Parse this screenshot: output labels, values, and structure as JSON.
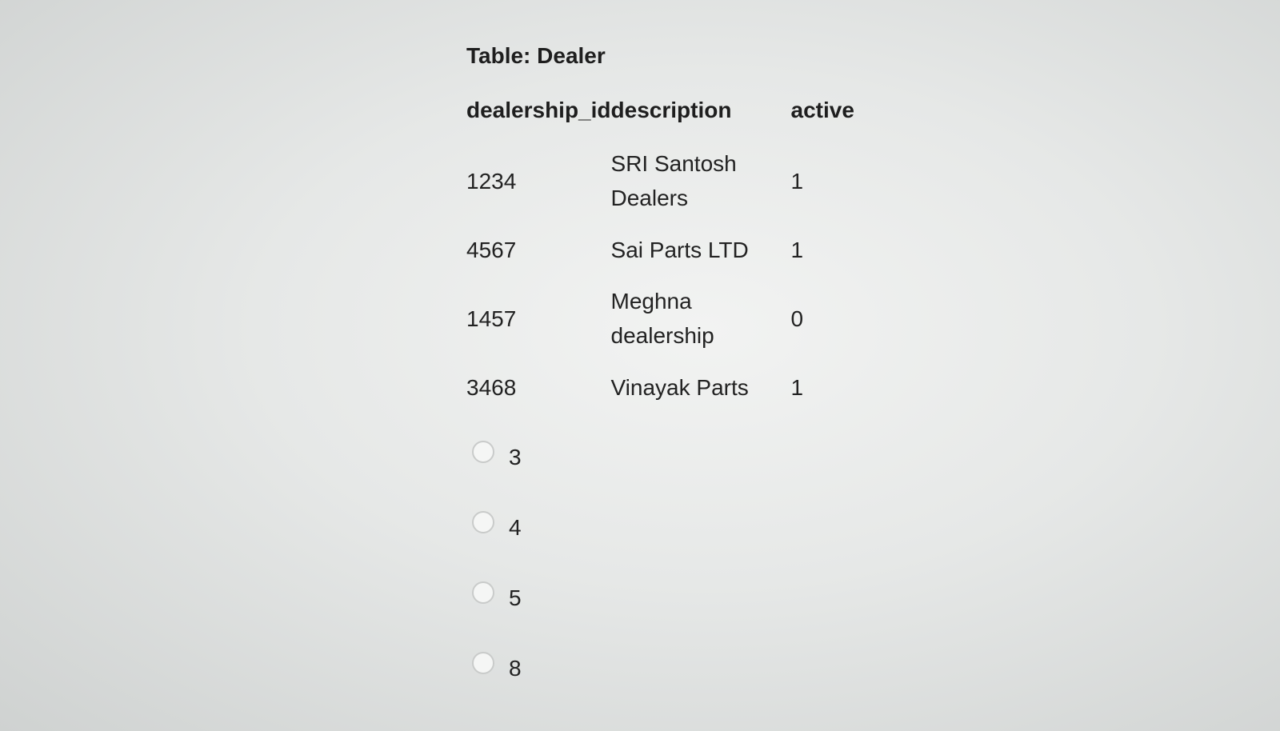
{
  "table": {
    "title": "Table: Dealer",
    "headers": [
      "dealership_id",
      "description",
      "active"
    ],
    "rows": [
      [
        "1234",
        "SRI Santosh Dealers",
        "1"
      ],
      [
        "4567",
        "Sai Parts LTD",
        "1"
      ],
      [
        "1457",
        "Meghna dealership",
        "0"
      ],
      [
        "3468",
        "Vinayak Parts",
        "1"
      ]
    ]
  },
  "options": [
    "3",
    "4",
    "5",
    "8"
  ]
}
